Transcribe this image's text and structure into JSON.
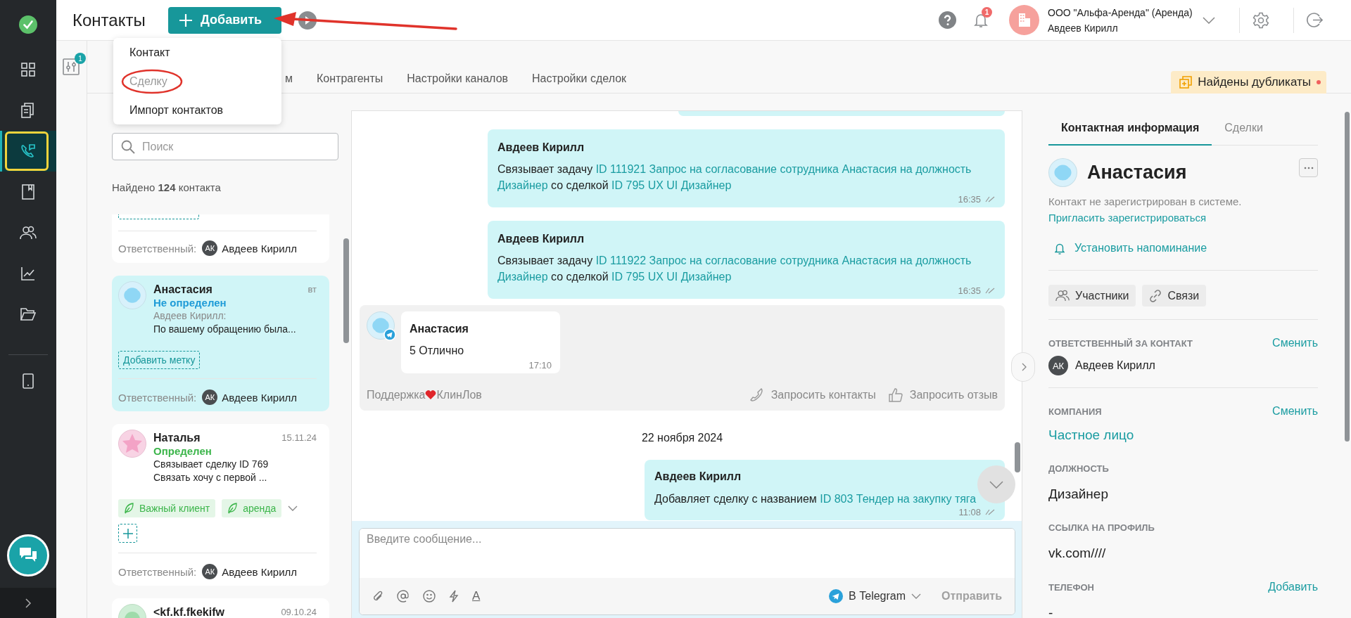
{
  "nav": [
    {
      "selected": false
    },
    {
      "selected": false
    },
    {
      "selected": true
    },
    {
      "selected": false
    },
    {
      "selected": false
    },
    {
      "selected": false
    },
    {
      "selected": false
    },
    {
      "selected": false
    }
  ],
  "header": {
    "title": "Контакты",
    "add_label": "Добавить",
    "notification_count": "1",
    "org": "ООО \"Альфа-Аренда\" (Аренда)",
    "user": "Авдеев Кирилл"
  },
  "add_menu": [
    {
      "label": "Контакт",
      "disabled": false
    },
    {
      "label": "Сделку",
      "disabled": true
    },
    {
      "label": "Импорт контактов",
      "disabled": false
    }
  ],
  "filter_count": "1",
  "tabs": [
    {
      "label": "м",
      "selected": false
    },
    {
      "label": "Контрагенты",
      "selected": false
    },
    {
      "label": "Настройки каналов",
      "selected": false
    },
    {
      "label": "Настройки сделок",
      "selected": false
    }
  ],
  "duplicates": "Найдены дубликаты",
  "search": {
    "placeholder": "Поиск"
  },
  "found": "Найдено **124** контакта",
  "contacts": [
    {
      "kind": "cut_top",
      "selected": false,
      "responsible_label": "Ответственный:",
      "responsible_initials": "АК",
      "responsible": "Авдеев Кирилл"
    },
    {
      "kind": "full",
      "selected": true,
      "avatar": {
        "kind": "blob"
      },
      "name": "Анастасия",
      "date": "вт",
      "status": {
        "text": "Не определен",
        "color": "#1e9bd7"
      },
      "lines": [
        {
          "text": "Авдеев Кирилл:",
          "muted": true
        },
        {
          "text": "По вашему обращению была...",
          "muted": false
        }
      ],
      "add_tag": "Добавить метку",
      "responsible_label": "Ответственный:",
      "responsible_initials": "АК",
      "responsible": "Авдеев Кирилл"
    },
    {
      "kind": "full",
      "selected": false,
      "avatar": {
        "kind": "star"
      },
      "name": "Наталья",
      "date": "15.11.24",
      "status": {
        "text": "Определен",
        "color": "#3bb54a"
      },
      "lines": [
        {
          "text": "Связывает сделку ID 769",
          "muted": false
        },
        {
          "text": "Связать хочу с первой ...",
          "muted": false
        }
      ],
      "tags": [
        "Важный клиент",
        "аренда"
      ],
      "responsible_label": "Ответственный:",
      "responsible_initials": "АК",
      "responsible": "Авдеев Кирилл"
    },
    {
      "kind": "full",
      "selected": false,
      "avatar": {
        "kind": "round"
      },
      "name": "<kf.kf.fkekifw",
      "date": "09.10.24"
    }
  ],
  "chat": {
    "messages": [
      {
        "kind": "cut"
      },
      {
        "kind": "outgoing",
        "author": "Авдеев Кирилл",
        "parts": [
          {
            "text": "Связывает задачу ",
            "link": false
          },
          {
            "text": "ID 111921 Запрос на согласование сотрудника Анастасия на должность",
            "link": true
          },
          {
            "text": "Дизайнер",
            "link": true
          },
          {
            "text": " со сделкой ",
            "link": false
          },
          {
            "text": "ID 795 UX UI Дизайнер",
            "link": true
          }
        ],
        "time": "16:35"
      },
      {
        "kind": "outgoing",
        "author": "Авдеев Кирилл",
        "parts": [
          {
            "text": "Связывает задачу ",
            "link": false
          },
          {
            "text": "ID 111922 Запрос на согласование сотрудника Анастасия на должность",
            "link": true
          },
          {
            "text": "Дизайнер",
            "link": true
          },
          {
            "text": " со сделкой ",
            "link": false
          },
          {
            "text": "ID 795 UX UI Дизайнер",
            "link": true
          }
        ],
        "time": "16:35"
      },
      {
        "kind": "incoming",
        "author": "Анастасия",
        "text": "5 Отлично",
        "time": "17:10",
        "channel": [
          "Поддержка",
          "КлинЛов"
        ],
        "actions": [
          "Запросить контакты",
          "Запросить отзыв"
        ]
      },
      {
        "kind": "date",
        "text": "22 ноября 2024"
      },
      {
        "kind": "outgoing",
        "author": "Авдеев Кирилл",
        "parts": [
          {
            "text": "Добавляет сделку с названием ",
            "link": false
          },
          {
            "text": "ID 803 Тендер на закупку тяга",
            "link": true
          }
        ],
        "time": "11:08"
      }
    ],
    "composer": {
      "placeholder": "Введите сообщение...",
      "format_glyph": "A",
      "channel": "В Telegram",
      "send": "Отправить"
    }
  },
  "details": {
    "tabs": [
      {
        "label": "Контактная информация",
        "selected": true
      },
      {
        "label": "Сделки",
        "selected": false
      }
    ],
    "name": "Анастасия",
    "note": "Контакт не зарегистрирован в системе.",
    "invite": "Пригласить зарегистрироваться",
    "reminder": "Установить напоминание",
    "chips": [
      "Участники",
      "Связи"
    ],
    "sections": [
      {
        "kind": "person",
        "label": "ОТВЕТСТВЕННЫЙ ЗА КОНТАКТ",
        "action": "Сменить",
        "initials": "АК",
        "value": "Авдеев Кирилл"
      },
      {
        "kind": "link",
        "label": "КОМПАНИЯ",
        "action": "Сменить",
        "value": "Частное лицо"
      },
      {
        "kind": "text",
        "label": "ДОЛЖНОСТЬ",
        "value": "Дизайнер"
      },
      {
        "kind": "text",
        "label": "ССЫЛКА НА ПРОФИЛЬ",
        "value": "vk.com////"
      },
      {
        "kind": "text",
        "label": "ТЕЛЕФОН",
        "action": "Добавить",
        "value": "-"
      }
    ]
  }
}
